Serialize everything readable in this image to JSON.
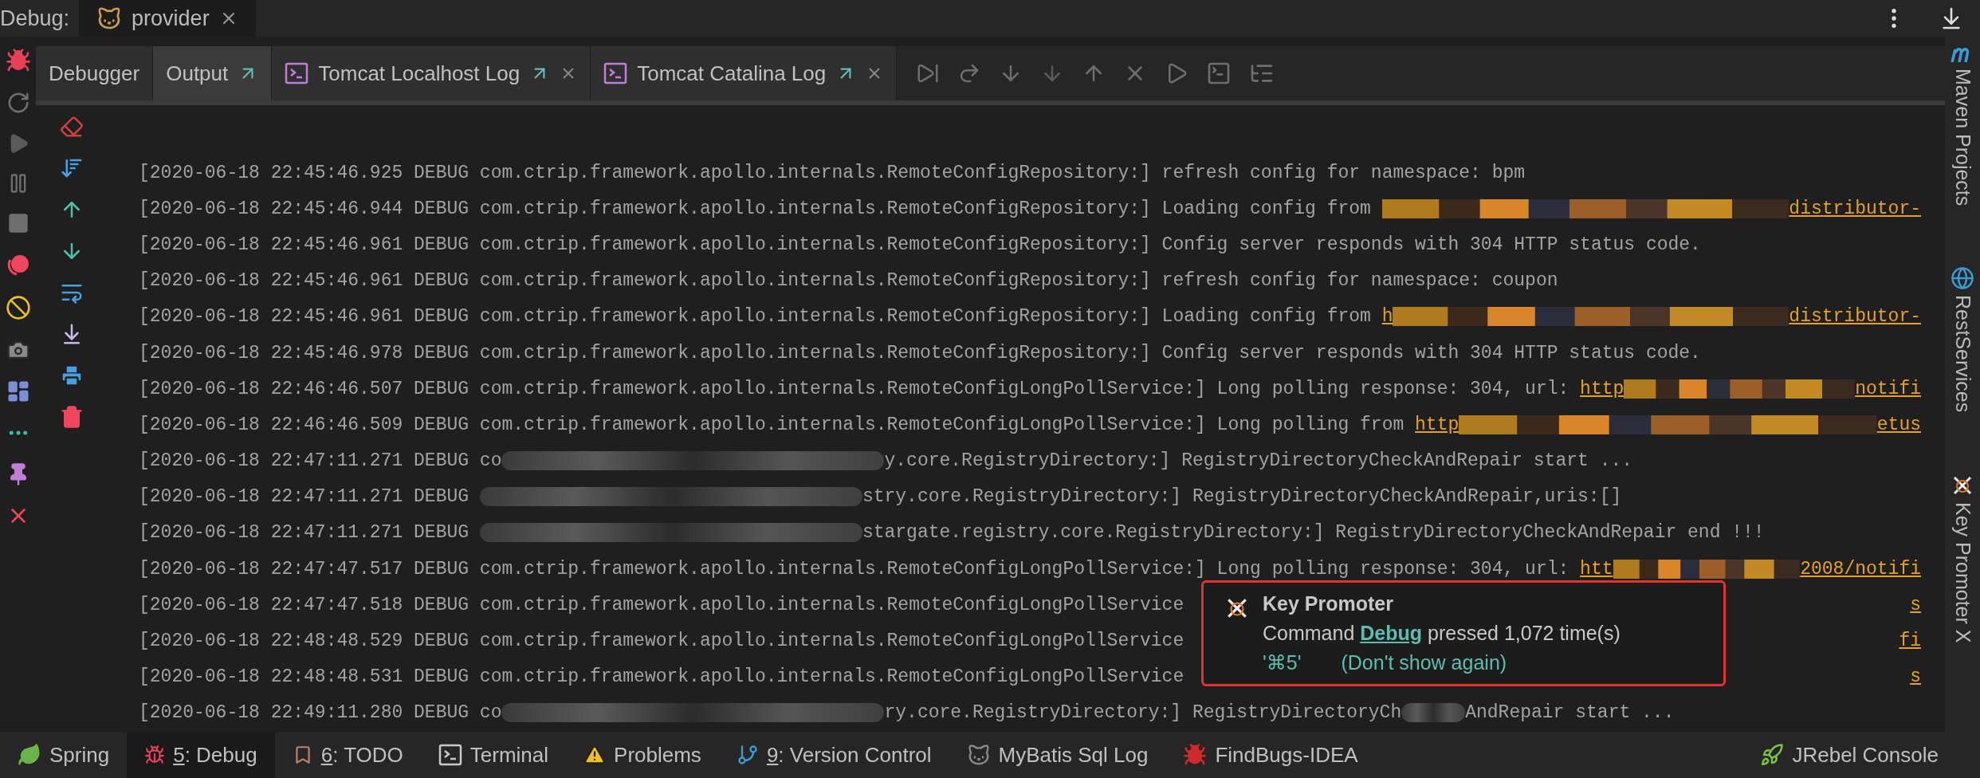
{
  "header": {
    "label": "Debug:",
    "session": {
      "label": "provider"
    }
  },
  "tabs": [
    {
      "label": "Debugger",
      "kind": "plain",
      "selected": false,
      "detached": false,
      "closable": false
    },
    {
      "label": "Output",
      "kind": "plain",
      "selected": true,
      "detached": true,
      "closable": false
    },
    {
      "label": "Tomcat Localhost Log",
      "kind": "console",
      "selected": false,
      "detached": true,
      "closable": true
    },
    {
      "label": "Tomcat Catalina Log",
      "kind": "console",
      "selected": false,
      "detached": true,
      "closable": true
    }
  ],
  "log_lines": [
    {
      "segments": [
        {
          "kind": "text",
          "text": "[2020-06-18 22:45:46.925 DEBUG com.ctrip.framework.apollo.internals.RemoteConfigRepository:] refresh config for namespace: bpm"
        }
      ]
    },
    {
      "segments": [
        {
          "kind": "text",
          "text": "[2020-06-18 22:45:46.944 DEBUG com.ctrip.framework.apollo.internals.RemoteConfigRepository:] Loading config from "
        },
        {
          "kind": "scribble"
        },
        {
          "kind": "link",
          "text": "distributor-"
        }
      ]
    },
    {
      "segments": [
        {
          "kind": "text",
          "text": "[2020-06-18 22:45:46.961 DEBUG com.ctrip.framework.apollo.internals.RemoteConfigRepository:] Config server responds with 304 HTTP status code."
        }
      ]
    },
    {
      "segments": [
        {
          "kind": "text",
          "text": "[2020-06-18 22:45:46.961 DEBUG com.ctrip.framework.apollo.internals.RemoteConfigRepository:] refresh config for namespace: coupon"
        }
      ]
    },
    {
      "segments": [
        {
          "kind": "text",
          "text": "[2020-06-18 22:45:46.961 DEBUG com.ctrip.framework.apollo.internals.RemoteConfigRepository:] Loading config from "
        },
        {
          "kind": "link",
          "text": "h"
        },
        {
          "kind": "scribble"
        },
        {
          "kind": "link",
          "text": "distributor-"
        }
      ]
    },
    {
      "segments": [
        {
          "kind": "text",
          "text": "[2020-06-18 22:45:46.978 DEBUG com.ctrip.framework.apollo.internals.RemoteConfigRepository:] Config server responds with 304 HTTP status code."
        }
      ]
    },
    {
      "segments": [
        {
          "kind": "text",
          "text": "[2020-06-18 22:46:46.507 DEBUG com.ctrip.framework.apollo.internals.RemoteConfigLongPollService:] Long polling response: 304, url: "
        },
        {
          "kind": "link",
          "text": "http"
        },
        {
          "kind": "scribble"
        },
        {
          "kind": "link",
          "text": "notifi"
        }
      ]
    },
    {
      "segments": [
        {
          "kind": "text",
          "text": "[2020-06-18 22:46:46.509 DEBUG com.ctrip.framework.apollo.internals.RemoteConfigLongPollService:] Long polling from "
        },
        {
          "kind": "link",
          "text": "http"
        },
        {
          "kind": "scribble"
        },
        {
          "kind": "link",
          "text": "etus"
        }
      ]
    },
    {
      "segments": [
        {
          "kind": "text",
          "text": "[2020-06-18 22:47:11.271 DEBUG co"
        },
        {
          "kind": "smudge"
        },
        {
          "kind": "text",
          "text": "y.core.RegistryDirectory:] RegistryDirectoryCheckAndRepair start ..."
        }
      ]
    },
    {
      "segments": [
        {
          "kind": "text",
          "text": "[2020-06-18 22:47:11.271 DEBUG "
        },
        {
          "kind": "smudge"
        },
        {
          "kind": "text",
          "text": "stry.core.RegistryDirectory:] RegistryDirectoryCheckAndRepair,uris:[]"
        }
      ]
    },
    {
      "segments": [
        {
          "kind": "text",
          "text": "[2020-06-18 22:47:11.271 DEBUG "
        },
        {
          "kind": "smudge"
        },
        {
          "kind": "text",
          "text": "stargate.registry.core.RegistryDirectory:] RegistryDirectoryCheckAndRepair end !!!"
        }
      ]
    },
    {
      "segments": [
        {
          "kind": "text",
          "text": "[2020-06-18 22:47:47.517 DEBUG com.ctrip.framework.apollo.internals.RemoteConfigLongPollService:] Long polling response: 304, url: "
        },
        {
          "kind": "link",
          "text": "htt"
        },
        {
          "kind": "scribble"
        },
        {
          "kind": "link",
          "text": "2008/notifi"
        }
      ]
    },
    {
      "segments": [
        {
          "kind": "text",
          "text": "[2020-06-18 22:47:47.518 DEBUG com.ctrip.framework.apollo.internals.RemoteConfigLongPollService"
        },
        {
          "kind": "gap"
        },
        {
          "kind": "link",
          "text": "s"
        }
      ]
    },
    {
      "segments": [
        {
          "kind": "text",
          "text": "[2020-06-18 22:48:48.529 DEBUG com.ctrip.framework.apollo.internals.RemoteConfigLongPollService"
        },
        {
          "kind": "gap"
        },
        {
          "kind": "link",
          "text": "fi"
        }
      ]
    },
    {
      "segments": [
        {
          "kind": "text",
          "text": "[2020-06-18 22:48:48.531 DEBUG com.ctrip.framework.apollo.internals.RemoteConfigLongPollService"
        },
        {
          "kind": "gap"
        },
        {
          "kind": "link",
          "text": "s"
        }
      ]
    },
    {
      "segments": [
        {
          "kind": "text",
          "text": "[2020-06-18 22:49:11.280 DEBUG co"
        },
        {
          "kind": "smudge"
        },
        {
          "kind": "text",
          "text": "ry.core.RegistryDirectory:] RegistryDirectoryCh"
        },
        {
          "kind": "blot"
        },
        {
          "kind": "text",
          "text": "AndRepair start ..."
        }
      ]
    }
  ],
  "popup": {
    "title": "Key Promoter",
    "message_before": "Command ",
    "command": "Debug",
    "message_after": " pressed 1,072 time(s)",
    "shortcut": "'⌘5'",
    "dismiss": "(Don't show again)"
  },
  "side_tools": [
    {
      "label": "Maven Projects",
      "kind": "maven"
    },
    {
      "label": "RestServices",
      "kind": "rest"
    },
    {
      "label": "Key Promoter X",
      "kind": "keypromoter"
    }
  ],
  "bottom_tools": [
    {
      "label": "Spring",
      "kind": "spring",
      "selected": false
    },
    {
      "mnemonic": "5",
      "label": ": Debug",
      "kind": "debug",
      "selected": true
    },
    {
      "mnemonic": "6",
      "label": ": TODO",
      "kind": "todo",
      "selected": false
    },
    {
      "label": "Terminal",
      "kind": "terminal",
      "selected": false
    },
    {
      "label": "Problems",
      "kind": "problems",
      "selected": false
    },
    {
      "mnemonic": "9",
      "label": ": Version Control",
      "kind": "vcs",
      "selected": false
    },
    {
      "label": "MyBatis Sql Log",
      "kind": "mybatis",
      "selected": false
    },
    {
      "label": "FindBugs-IDEA",
      "kind": "findbugs",
      "selected": false
    }
  ],
  "bottom_tools_right": [
    {
      "label": "JRebel Console",
      "kind": "jrebel",
      "selected": false
    }
  ]
}
